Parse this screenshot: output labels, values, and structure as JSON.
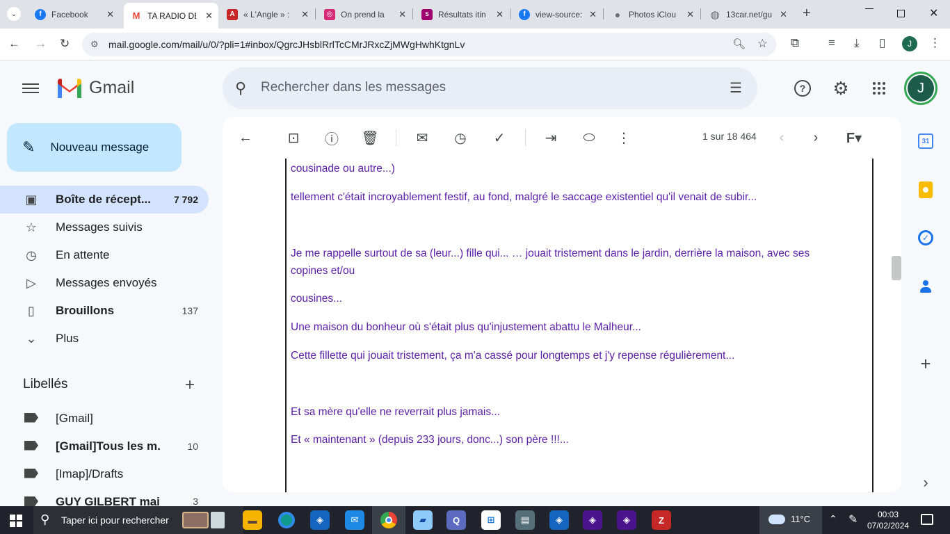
{
  "browser": {
    "tabs": [
      {
        "label": "Facebook",
        "icon": "facebook-icon",
        "color": "#1877f2",
        "glyph": "f"
      },
      {
        "label": "TA RADIO DE",
        "icon": "gmail-icon",
        "color": "#ea4335",
        "glyph": "M"
      },
      {
        "label": "« L'Angle » :",
        "icon": "news-icon",
        "color": "#c62828",
        "glyph": "A"
      },
      {
        "label": "On prend la",
        "icon": "instagram-icon",
        "color": "#d62976",
        "glyph": "◎"
      },
      {
        "label": "Résultats itin",
        "icon": "sncf-icon",
        "color": "#a0006e",
        "glyph": "S"
      },
      {
        "label": "view-source:",
        "icon": "facebook-icon",
        "color": "#1877f2",
        "glyph": "f"
      },
      {
        "label": "Photos iClou",
        "icon": "apple-icon",
        "color": "#6e6e73",
        "glyph": ""
      },
      {
        "label": "13car.net/gu",
        "icon": "globe-icon",
        "color": "#5f6368",
        "glyph": "◍"
      }
    ],
    "new_tab": "+",
    "url": "mail.google.com/mail/u/0/?pli=1#inbox/QgrcJHsblRrlTcCMrJRxcZjMWgHwhKtgnLv",
    "profile_initial": "J"
  },
  "gmail": {
    "wordmark": "Gmail",
    "search_placeholder": "Rechercher dans les messages",
    "avatar_initial": "J",
    "compose_label": "Nouveau message",
    "nav": [
      {
        "label": "Boîte de récept...",
        "count": "7 792",
        "icon": "inbox-icon"
      },
      {
        "label": "Messages suivis",
        "count": "",
        "icon": "star-icon"
      },
      {
        "label": "En attente",
        "count": "",
        "icon": "clock-icon"
      },
      {
        "label": "Messages envoyés",
        "count": "",
        "icon": "send-icon"
      },
      {
        "label": "Brouillons",
        "count": "137",
        "icon": "draft-icon"
      },
      {
        "label": "Plus",
        "count": "",
        "icon": "chevron-down-icon"
      }
    ],
    "labels_heading": "Libellés",
    "labels": [
      {
        "label": "[Gmail]",
        "count": ""
      },
      {
        "label": "[Gmail]Tous les m...",
        "count": "10"
      },
      {
        "label": "[Imap]/Drafts",
        "count": ""
      },
      {
        "label": "GUY GILBERT mail...",
        "count": "3"
      }
    ],
    "pager": "1 sur 18 464",
    "message_paragraphs": [
      "cousinade ou autre...)",
      "tellement c'était incroyablement festif, au fond, malgré le saccage existentiel qu'il venait de subir...",
      "Je me rappelle surtout de sa (leur...) fille qui... … jouait tristement dans le jardin, derrière la maison, avec ses copines et/ou",
      "cousines...",
      "Une maison du bonheur où s'était plus qu'injustement abattu le Malheur...",
      "Cette fillette qui jouait tristement, ça m'a cassé pour longtemps et j'y repense régulièrement...",
      "Et sa mère qu'elle ne reverrait plus jamais...",
      "Et « maintenant » (depuis 233 jours, donc...) son père !!!..."
    ]
  },
  "taskbar": {
    "search_placeholder": "Taper ici pour rechercher",
    "temperature": "11°C",
    "time": "00:03",
    "date": "07/02/2024"
  },
  "colors": {
    "compose_bg": "#c2e7ff",
    "active_nav_bg": "#d3e3fd",
    "message_text": "#5b20a8"
  }
}
